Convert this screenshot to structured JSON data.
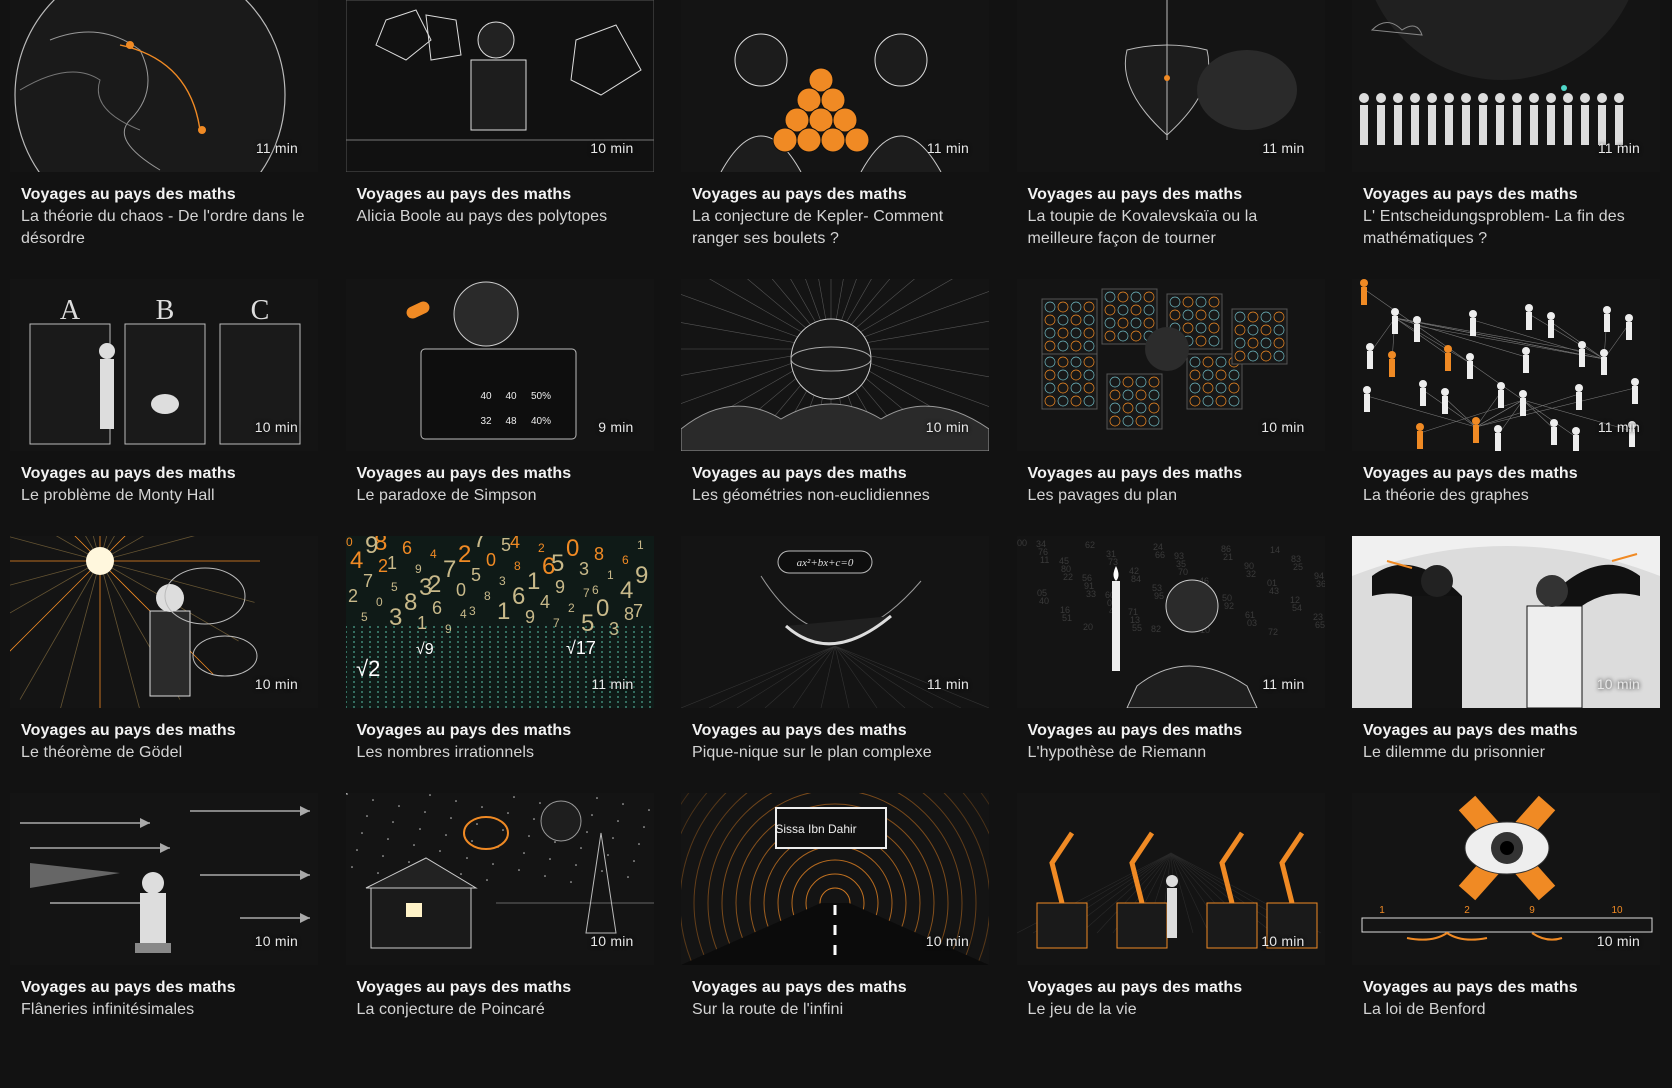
{
  "series_label": "Voyages au pays des maths",
  "colors": {
    "background": "#121212",
    "accent": "#f08a24",
    "text": "#f2f2f2"
  },
  "episodes": [
    {
      "title": "La théorie du chaos - De l'ordre dans le désordre",
      "duration": "11 min",
      "thumb_icon": "globe-icon"
    },
    {
      "title": "Alicia Boole au pays des polytopes",
      "duration": "10 min",
      "thumb_icon": "polytope-icon"
    },
    {
      "title": "La conjecture de Kepler- Comment ranger ses boulets ?",
      "duration": "11 min",
      "thumb_icon": "orange-pyramid-icon"
    },
    {
      "title": "La toupie de Kovalevskaïa ou la meilleure façon de tourner",
      "duration": "11 min",
      "thumb_icon": "spinning-top-icon"
    },
    {
      "title": "L' Entscheidungsproblem- La fin des mathématiques ?",
      "duration": "11 min",
      "thumb_icon": "crowd-icon"
    },
    {
      "title": "Le problème de Monty Hall",
      "duration": "10 min",
      "thumb_icon": "doors-icon"
    },
    {
      "title": "Le paradoxe de Simpson",
      "duration": "9 min",
      "thumb_icon": "table-icon"
    },
    {
      "title": "Les géométries non-euclidiennes",
      "duration": "10 min",
      "thumb_icon": "sphere-icon"
    },
    {
      "title": "Les pavages du plan",
      "duration": "10 min",
      "thumb_icon": "tiling-icon"
    },
    {
      "title": "La théorie des graphes",
      "duration": "11 min",
      "thumb_icon": "graph-network-icon"
    },
    {
      "title": "Le théorème de Gödel",
      "duration": "10 min",
      "thumb_icon": "lamp-man-icon"
    },
    {
      "title": "Les nombres irrationnels",
      "duration": "11 min",
      "thumb_icon": "numbers-rain-icon"
    },
    {
      "title": "Pique-nique sur le plan complexe",
      "duration": "11 min",
      "thumb_icon": "hammock-icon"
    },
    {
      "title": "L'hypothèse de Riemann",
      "duration": "11 min",
      "thumb_icon": "candle-writer-icon"
    },
    {
      "title": "Le dilemme du prisonnier",
      "duration": "10 min",
      "thumb_icon": "prisoners-icon"
    },
    {
      "title": "Flâneries infinitésimales",
      "duration": "10 min",
      "thumb_icon": "arrows-icon"
    },
    {
      "title": "La conjecture de Poincaré",
      "duration": "10 min",
      "thumb_icon": "cabin-icon"
    },
    {
      "title": "Sur la route de l'infini",
      "duration": "10 min",
      "thumb_icon": "road-tunnel-icon"
    },
    {
      "title": "Le jeu de la vie",
      "duration": "10 min",
      "thumb_icon": "robot-arms-icon"
    },
    {
      "title": "La loi de Benford",
      "duration": "10 min",
      "thumb_icon": "eye-cross-icon"
    }
  ],
  "thumb_text": {
    "monty_hall_doors": [
      "A",
      "B",
      "C"
    ],
    "simpson_table": [
      "40",
      "40",
      "50%",
      "32",
      "48",
      "40%"
    ],
    "equation": "ax²+bx+c=0",
    "road_sign": "Sissa Ibn Dahir",
    "benford_ticks": [
      "1",
      "2",
      "9",
      "10"
    ],
    "irrational_symbols": [
      "√2",
      "√9",
      "√17"
    ]
  }
}
